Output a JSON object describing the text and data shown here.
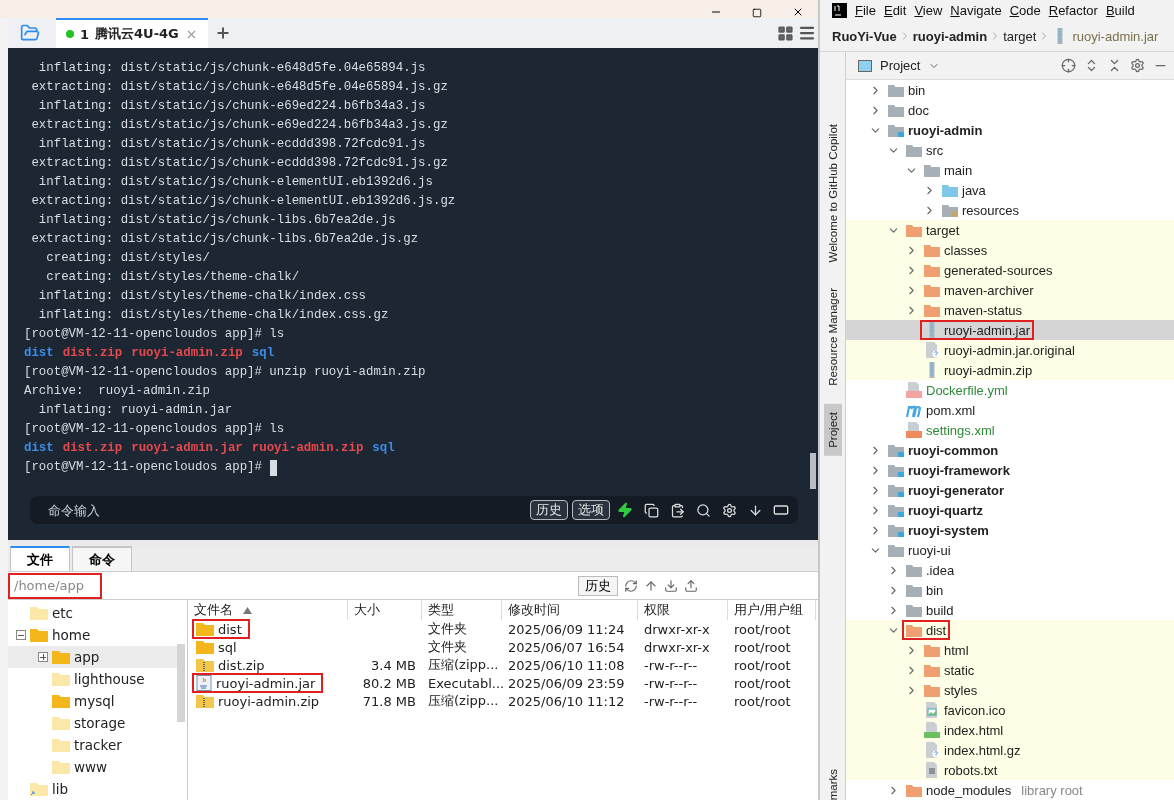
{
  "session_tabs": [
    {
      "number": "1",
      "label": "腾讯云4U-4G",
      "selected": true,
      "connected": true
    }
  ],
  "terminal": {
    "lines": [
      {
        "kind": "text",
        "text": "  inflating: dist/static/js/chunk-e648d5fe.04e65894.js"
      },
      {
        "kind": "text",
        "text": " extracting: dist/static/js/chunk-e648d5fe.04e65894.js.gz"
      },
      {
        "kind": "text",
        "text": "  inflating: dist/static/js/chunk-e69ed224.b6fb34a3.js"
      },
      {
        "kind": "text",
        "text": " extracting: dist/static/js/chunk-e69ed224.b6fb34a3.js.gz"
      },
      {
        "kind": "text",
        "text": "  inflating: dist/static/js/chunk-ecddd398.72fcdc91.js"
      },
      {
        "kind": "text",
        "text": " extracting: dist/static/js/chunk-ecddd398.72fcdc91.js.gz"
      },
      {
        "kind": "text",
        "text": "  inflating: dist/static/js/chunk-elementUI.eb1392d6.js"
      },
      {
        "kind": "text",
        "text": " extracting: dist/static/js/chunk-elementUI.eb1392d6.js.gz"
      },
      {
        "kind": "text",
        "text": "  inflating: dist/static/js/chunk-libs.6b7ea2de.js"
      },
      {
        "kind": "text",
        "text": " extracting: dist/static/js/chunk-libs.6b7ea2de.js.gz"
      },
      {
        "kind": "text",
        "text": "   creating: dist/styles/"
      },
      {
        "kind": "text",
        "text": "   creating: dist/styles/theme-chalk/"
      },
      {
        "kind": "text",
        "text": "  inflating: dist/styles/theme-chalk/index.css"
      },
      {
        "kind": "text",
        "text": "  inflating: dist/styles/theme-chalk/index.css.gz"
      },
      {
        "kind": "text",
        "text": "[root@VM-12-11-opencloudos app]# ls"
      },
      {
        "kind": "listing",
        "items": [
          {
            "text": "dist",
            "color": "#3b8eea"
          },
          {
            "text": "dist.zip",
            "color": "#e5484d"
          },
          {
            "text": "ruoyi-admin.zip",
            "color": "#e5484d"
          },
          {
            "text": "sql",
            "color": "#3b8eea"
          }
        ]
      },
      {
        "kind": "text",
        "text": "[root@VM-12-11-opencloudos app]# unzip ruoyi-admin.zip"
      },
      {
        "kind": "text",
        "text": "Archive:  ruoyi-admin.zip"
      },
      {
        "kind": "text",
        "text": "  inflating: ruoyi-admin.jar"
      },
      {
        "kind": "text",
        "text": "[root@VM-12-11-opencloudos app]# ls"
      },
      {
        "kind": "listing",
        "items": [
          {
            "text": "dist",
            "color": "#3b8eea"
          },
          {
            "text": "dist.zip",
            "color": "#e5484d"
          },
          {
            "text": "ruoyi-admin.jar",
            "color": "#e5484d"
          },
          {
            "text": "ruoyi-admin.zip",
            "color": "#e5484d"
          },
          {
            "text": "sql",
            "color": "#3b8eea"
          }
        ]
      },
      {
        "kind": "prompt",
        "text": "[root@VM-12-11-opencloudos app]#"
      }
    ],
    "command_input": {
      "placeholder": "命令输入"
    },
    "buttons": [
      "历史",
      "选项"
    ]
  },
  "bottom_tabs": [
    {
      "label": "文件",
      "selected": true
    },
    {
      "label": "命令",
      "selected": false
    }
  ],
  "path_field": {
    "value": "/home/app",
    "highlighted": true
  },
  "history_button": "历史",
  "folder_tree": [
    {
      "name": "etc",
      "faded": true,
      "selected": false
    },
    {
      "name": "home",
      "faded": false,
      "selected": false,
      "expanded": true,
      "children": [
        {
          "name": "app",
          "faded": false,
          "selected": true,
          "expanded": false
        },
        {
          "name": "lighthouse",
          "faded": true,
          "selected": false
        },
        {
          "name": "mysql",
          "faded": false,
          "selected": false
        },
        {
          "name": "storage",
          "faded": true,
          "selected": false
        },
        {
          "name": "tracker",
          "faded": true,
          "selected": false
        },
        {
          "name": "www",
          "faded": true,
          "selected": false
        }
      ]
    },
    {
      "name": "lib",
      "faded": true,
      "selected": false,
      "link": true
    }
  ],
  "file_table": {
    "columns": [
      {
        "label": "文件名",
        "sorted": true
      },
      {
        "label": "大小",
        "sorted": false
      },
      {
        "label": "类型",
        "sorted": false
      },
      {
        "label": "修改时间",
        "sorted": false
      },
      {
        "label": "权限",
        "sorted": false
      },
      {
        "label": "用户/用户组",
        "sorted": false
      }
    ],
    "rows": [
      {
        "kind": "folder",
        "highlighted": true,
        "cells": [
          "dist",
          "",
          "文件夹",
          "2025/06/09 11:24",
          "drwxr-xr-x",
          "root/root"
        ]
      },
      {
        "kind": "folder",
        "highlighted": false,
        "cells": [
          "sql",
          "",
          "文件夹",
          "2025/06/07 16:54",
          "drwxr-xr-x",
          "root/root"
        ]
      },
      {
        "kind": "zip",
        "highlighted": false,
        "cells": [
          "dist.zip",
          "3.4 MB",
          "压缩(zipp...",
          "2025/06/10 11:08",
          "-rw-r--r--",
          "root/root"
        ]
      },
      {
        "kind": "jar",
        "highlighted": true,
        "cells": [
          "ruoyi-admin.jar",
          "80.2 MB",
          "Executabl...",
          "2025/06/09 23:59",
          "-rw-r--r--",
          "root/root"
        ]
      },
      {
        "kind": "zip",
        "highlighted": false,
        "cells": [
          "ruoyi-admin.zip",
          "71.8 MB",
          "压缩(zipp...",
          "2025/06/10 11:12",
          "-rw-r--r--",
          "root/root"
        ]
      }
    ]
  },
  "ide": {
    "menu": [
      "File",
      "Edit",
      "View",
      "Navigate",
      "Code",
      "Refactor",
      "Build"
    ],
    "breadcrumbs": [
      {
        "label": "RuoYi-Vue",
        "kind": "project"
      },
      {
        "label": "ruoyi-admin",
        "kind": "module"
      },
      {
        "label": "target",
        "kind": "folder"
      },
      {
        "label": "ruoyi-admin.jar",
        "kind": "jar"
      }
    ],
    "side_tabs": [
      {
        "label": "Welcome to GitHub Copilot",
        "selected": false
      },
      {
        "label": "Resource Manager",
        "selected": false
      },
      {
        "label": "Project",
        "selected": true
      }
    ],
    "bottom_side_tab": "marks",
    "panel_title": "Project",
    "tree": [
      {
        "name": "bin",
        "kind": "folder",
        "expanded": false
      },
      {
        "name": "doc",
        "kind": "folder",
        "expanded": false
      },
      {
        "name": "ruoyi-admin",
        "kind": "module",
        "expanded": true,
        "children": [
          {
            "name": "src",
            "kind": "folder",
            "expanded": true,
            "children": [
              {
                "name": "main",
                "kind": "folder",
                "expanded": true,
                "children": [
                  {
                    "name": "java",
                    "kind": "source-folder",
                    "expanded": false
                  },
                  {
                    "name": "resources",
                    "kind": "resource-folder",
                    "expanded": false
                  }
                ]
              }
            ]
          },
          {
            "name": "target",
            "kind": "excluded-folder",
            "expanded": true,
            "ignored": true,
            "children": [
              {
                "name": "classes",
                "kind": "excluded-folder",
                "expanded": false
              },
              {
                "name": "generated-sources",
                "kind": "excluded-folder",
                "expanded": false
              },
              {
                "name": "maven-archiver",
                "kind": "excluded-folder",
                "expanded": false
              },
              {
                "name": "maven-status",
                "kind": "excluded-folder",
                "expanded": false
              },
              {
                "name": "ruoyi-admin.jar",
                "kind": "jar",
                "selected": true,
                "highlighted": true
              },
              {
                "name": "ruoyi-admin.jar.original",
                "kind": "unknown-file"
              },
              {
                "name": "ruoyi-admin.zip",
                "kind": "jar"
              }
            ]
          },
          {
            "name": "Dockerfile.yml",
            "kind": "yml",
            "added": true
          },
          {
            "name": "pom.xml",
            "kind": "maven"
          },
          {
            "name": "settings.xml",
            "kind": "xml",
            "added": true
          }
        ]
      },
      {
        "name": "ruoyi-common",
        "kind": "module",
        "expanded": false
      },
      {
        "name": "ruoyi-framework",
        "kind": "module",
        "expanded": false
      },
      {
        "name": "ruoyi-generator",
        "kind": "module",
        "expanded": false
      },
      {
        "name": "ruoyi-quartz",
        "kind": "module",
        "expanded": false
      },
      {
        "name": "ruoyi-system",
        "kind": "module",
        "expanded": false
      },
      {
        "name": "ruoyi-ui",
        "kind": "folder",
        "expanded": true,
        "children": [
          {
            "name": ".idea",
            "kind": "folder",
            "expanded": false
          },
          {
            "name": "bin",
            "kind": "folder",
            "expanded": false
          },
          {
            "name": "build",
            "kind": "folder",
            "expanded": false
          },
          {
            "name": "dist",
            "kind": "excluded-folder",
            "expanded": true,
            "ignored": true,
            "highlighted": true,
            "children": [
              {
                "name": "html",
                "kind": "excluded-folder",
                "expanded": false
              },
              {
                "name": "static",
                "kind": "excluded-folder",
                "expanded": false
              },
              {
                "name": "styles",
                "kind": "excluded-folder",
                "expanded": false
              },
              {
                "name": "favicon.ico",
                "kind": "image"
              },
              {
                "name": "index.html",
                "kind": "html"
              },
              {
                "name": "index.html.gz",
                "kind": "unknown-file"
              },
              {
                "name": "robots.txt",
                "kind": "text"
              }
            ]
          },
          {
            "name": "node_modules",
            "kind": "excluded-folder",
            "expanded": false,
            "suffix": "library root"
          }
        ]
      }
    ]
  }
}
